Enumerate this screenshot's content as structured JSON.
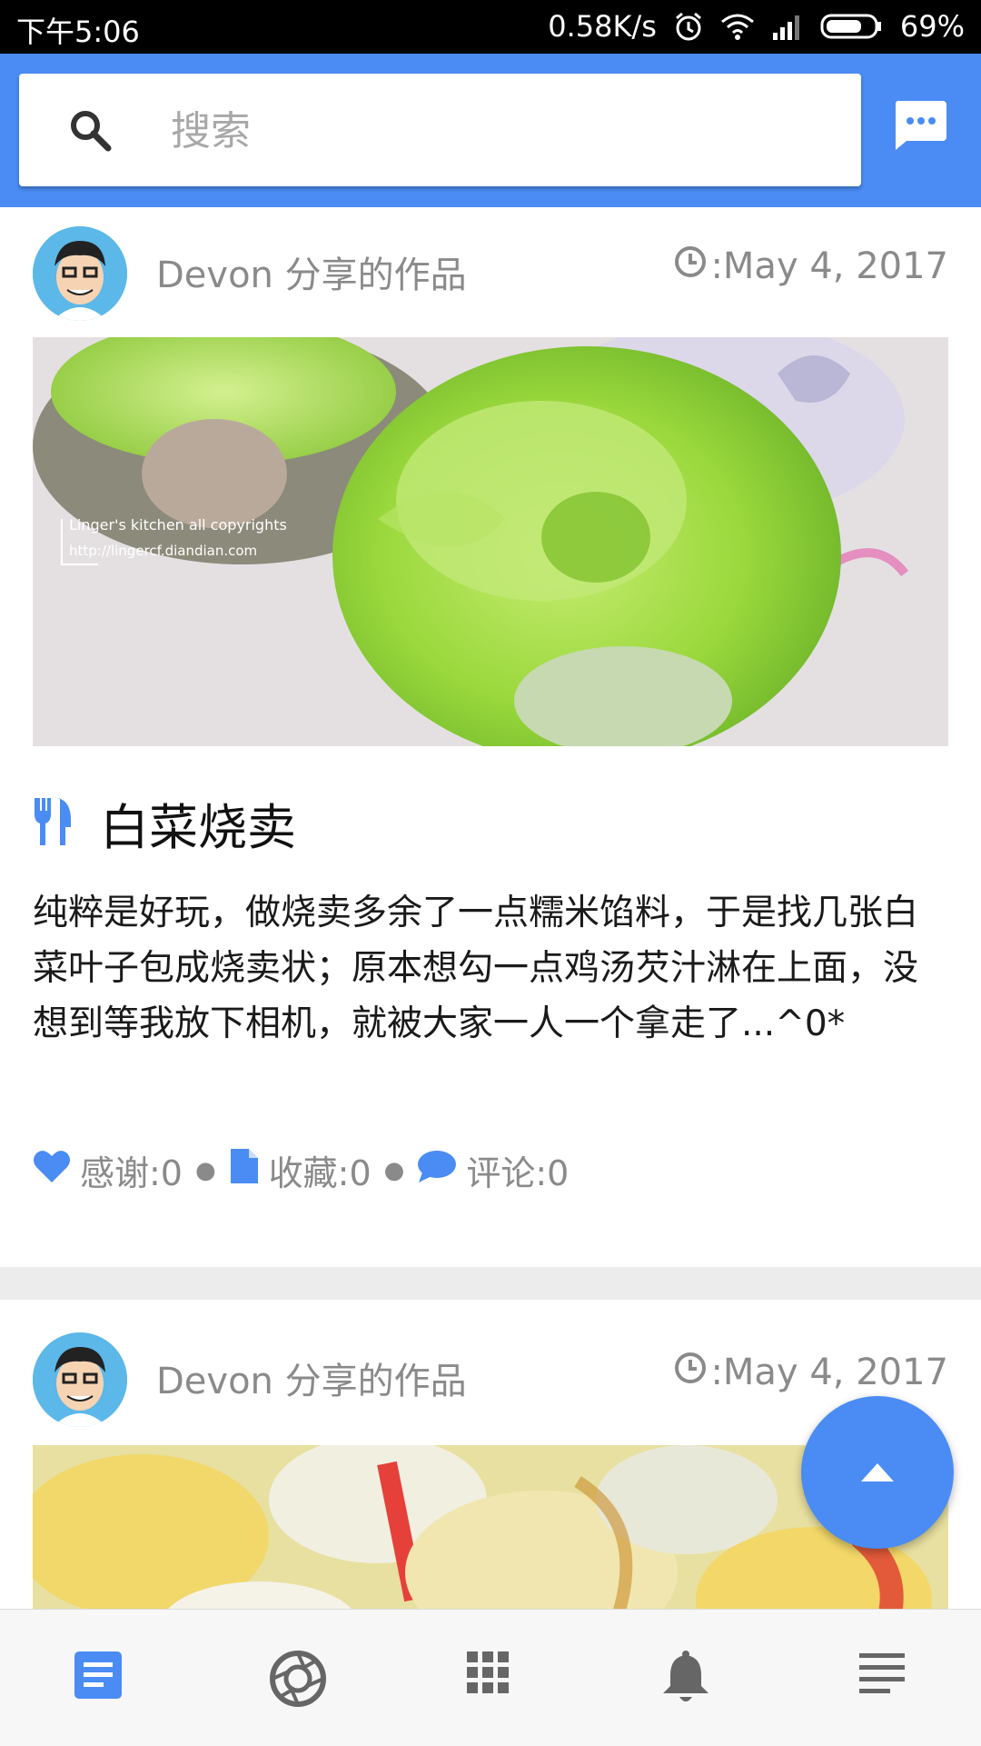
{
  "status_bar": {
    "time": "下午5:06",
    "network_speed": "0.58K/s",
    "battery": "69%"
  },
  "search": {
    "placeholder": "搜索",
    "value": ""
  },
  "colors": {
    "accent": "#4a8cf3",
    "muted_text": "#8a8a8a"
  },
  "posts": [
    {
      "author": "Devon 分享的作品",
      "date": ":May 4, 2017",
      "title": "白菜烧卖",
      "description": "纯粹是好玩，做烧卖多余了一点糯米馅料，于是找几张白菜叶子包成烧卖状；原本想勾一点鸡汤芡汁淋在上面，没想到等我放下相机，就被大家一人一个拿走了...^0*",
      "image_caption_line1": "Linger's kitchen all copyrights",
      "image_caption_line2": "http://lingercf.diandian.com",
      "thanks": "感谢:0",
      "favorites": "收藏:0",
      "comments": "评论:0"
    },
    {
      "author": "Devon 分享的作品",
      "date": ":May 4, 2017"
    }
  ],
  "bottom_nav": [
    {
      "icon": "article-icon",
      "active": true
    },
    {
      "icon": "camera-shutter-icon",
      "active": false
    },
    {
      "icon": "grid-icon",
      "active": false
    },
    {
      "icon": "bell-icon",
      "active": false
    },
    {
      "icon": "menu-lines-icon",
      "active": false
    }
  ]
}
